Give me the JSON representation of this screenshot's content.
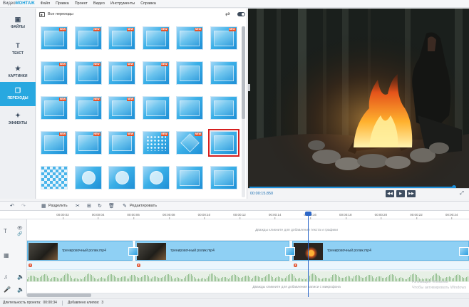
{
  "app": {
    "logo_part1": "Видео",
    "logo_part2": "МОНТАЖ"
  },
  "menu": [
    "Файл",
    "Правка",
    "Проект",
    "Видео",
    "Инструменты",
    "Справка"
  ],
  "sidebar": {
    "items": [
      {
        "label": "ФАЙЛЫ",
        "icon": "files-icon"
      },
      {
        "label": "ТЕКСТ",
        "icon": "text-icon"
      },
      {
        "label": "КАРТИНКИ",
        "icon": "pictures-icon"
      },
      {
        "label": "ПЕРЕХОДЫ",
        "icon": "transitions-icon",
        "active": true
      },
      {
        "label": "ЭФФЕКТЫ",
        "icon": "effects-icon"
      }
    ]
  },
  "transitions": {
    "title": "Все переходы",
    "badge_label": "NEW",
    "selected_index": 23
  },
  "preview": {
    "current_time": "00:00:15.850",
    "progress_fraction": 0.99
  },
  "toolbar": {
    "split_label": "Разделить",
    "edit_label": "Редактировать"
  },
  "ruler": {
    "ticks": [
      "00:00:02",
      "00:00:04",
      "00:00:06",
      "00:00:08",
      "00:00:10",
      "00:00:12",
      "00:00:14",
      "00:00:16",
      "00:00:18",
      "00:00:20",
      "00:00:22",
      "00:00:24"
    ]
  },
  "timeline": {
    "text_hint": "Дважды кликните для добавления текста и графики",
    "mic_hint": "Дважды кликните для добавления записи с микрофона",
    "clips": [
      {
        "name": "тренировочный ролик.mp4"
      },
      {
        "name": "тренировочный ролик.mp4"
      },
      {
        "name": "тренировочный ролик.mp4"
      }
    ]
  },
  "status": {
    "duration_label": "Длительность проекта:",
    "duration_value": "00:00:34",
    "clips_label": "Добавлено клипов:",
    "clips_value": "3"
  },
  "watermark": {
    "line1": "Активация Windows",
    "line2": "Чтобы активировать Windows"
  }
}
